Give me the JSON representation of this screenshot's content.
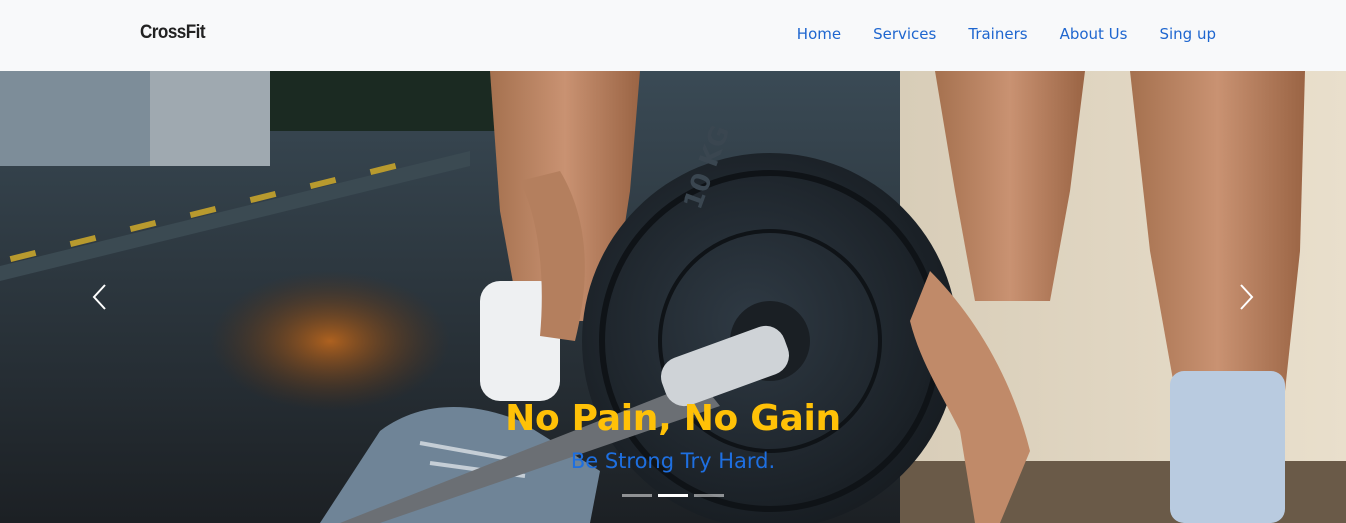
{
  "navbar": {
    "brand": "CrossFit",
    "links": [
      "Home",
      "Services",
      "Trainers",
      "About Us",
      "Sing up"
    ]
  },
  "carousel": {
    "caption_title": "No Pain, No Gain",
    "caption_subtitle": "Be Strong Try Hard.",
    "active_slide": 2,
    "slide_count": 3,
    "prev_icon": "chevron-left-icon",
    "next_icon": "chevron-right-icon"
  },
  "colors": {
    "navbar_bg": "#f8f9fa",
    "link": "#1e66cf",
    "caption_title": "#ffc107",
    "caption_subtitle": "#1e6fe0"
  }
}
